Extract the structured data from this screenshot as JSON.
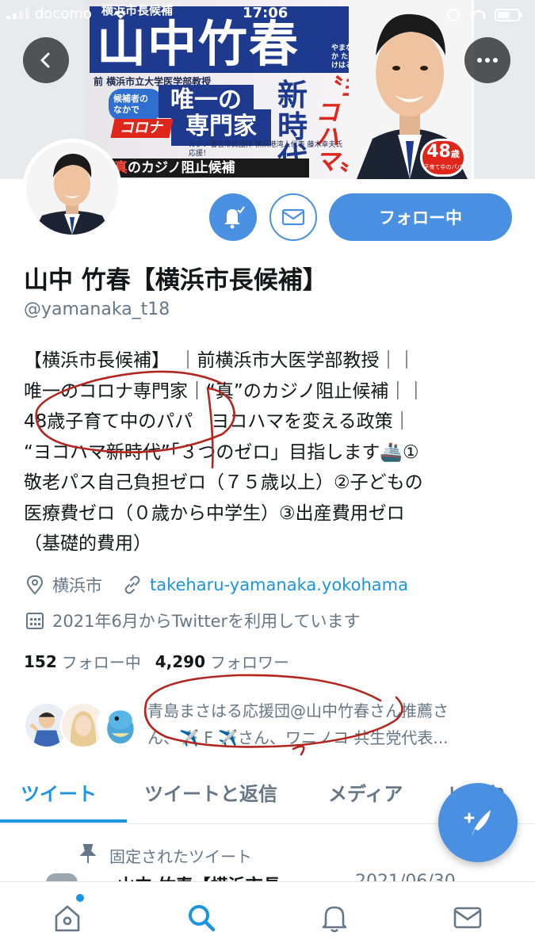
{
  "status_bar": {
    "carrier": "docomo",
    "time": "17:06"
  },
  "banner": {
    "kicker": "横浜市長候補",
    "name": "山中竹春",
    "reading": "やまなか たけはる",
    "title": "前 横浜市立大学医学部教授",
    "candidates_label": "候補者の なかで",
    "unique": "唯一の",
    "corona": "コロナ",
    "expert": "専門家",
    "new_era": "新時代",
    "yokohama": "〝ヨコハマ〟",
    "endorse": "カジノ署名市民団体 横浜港湾人代表 藤木幸夫氏 応援！",
    "casino_prefix": "真",
    "casino_text": "のカジノ阻止候補",
    "age_num": "48",
    "age_unit": "歳",
    "age_sub": "子育て中のパパ"
  },
  "profile": {
    "display_name": "山中 竹春【横浜市長候補】",
    "handle": "@yamanaka_t18",
    "follow_label": "フォロー中",
    "bio_lines": [
      "【横浜市長候補】　｜前横浜市大医学部教授｜｜",
      "唯一のコロナ専門家｜“真”のカジノ阻止候補｜｜",
      "48歳子育て中のパパ　ヨコハマを変える政策｜",
      "“ヨコハマ新時代”「３つのゼロ」目指します🚢①",
      "敬老パス自己負担ゼロ（７５歳以上）②子どもの",
      "医療費ゼロ（０歳から中学生）③出産費用ゼロ",
      "（基礎的費用）"
    ],
    "location": "横浜市",
    "url": "takeharu-yamanaka.yokohama",
    "joined": "2021年6月からTwitterを利用しています",
    "following_count": "152",
    "following_label": "フォロー中",
    "followers_count": "4,290",
    "followers_label": "フォロワー",
    "followed_by_line1": "青島まさはる応援団@山中竹春さん推薦さ",
    "followed_by_line2": "ん、✈️ F ✈️さん、ワニノコ 共生党代表..."
  },
  "tabs": [
    {
      "label": "ツイート",
      "active": true
    },
    {
      "label": "ツイートと返信",
      "active": false
    },
    {
      "label": "メディア",
      "active": false
    },
    {
      "label": "いいね",
      "active": false
    }
  ],
  "pinned": {
    "label": "固定されたツイート",
    "partial_name": "山中 竹春【横浜市長",
    "partial_date": "2021/06/30"
  },
  "colors": {
    "accent": "#1b95e0",
    "button": "#4a90e2",
    "text": "#14171a",
    "secondary": "#657786",
    "annotation": "#b3261e"
  },
  "icons": [
    "back-arrow-icon",
    "more-icon",
    "bell-check-icon",
    "mail-icon",
    "location-pin-icon",
    "link-icon",
    "calendar-icon",
    "pin-icon",
    "compose-feather-icon",
    "home-icon",
    "search-icon",
    "notifications-bell-icon",
    "messages-icon"
  ]
}
